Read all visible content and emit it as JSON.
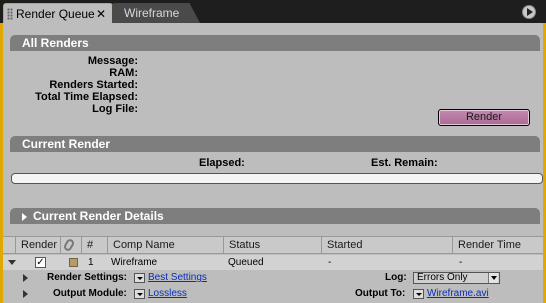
{
  "tabs": [
    {
      "label": "Render Queue",
      "close": "✕"
    },
    {
      "label": "Wireframe"
    }
  ],
  "all_renders": {
    "title": "All Renders",
    "fields": [
      {
        "label": "Message:"
      },
      {
        "label": "RAM:"
      },
      {
        "label": "Renders Started:"
      },
      {
        "label": "Total Time Elapsed:"
      },
      {
        "label": "Log File:"
      }
    ],
    "render_button": "Render"
  },
  "current_render": {
    "title": "Current Render",
    "elapsed_label": "Elapsed:",
    "remain_label": "Est. Remain:",
    "progress": 0
  },
  "details": {
    "title": "Current Render Details"
  },
  "table": {
    "headers": {
      "render": "Render",
      "num": "#",
      "comp": "Comp Name",
      "status": "Status",
      "started": "Started",
      "time": "Render Time"
    },
    "item": {
      "checked": "✓",
      "num": "1",
      "comp": "Wireframe",
      "status": "Queued",
      "started": "-",
      "time": "-"
    },
    "render_settings": {
      "label": "Render Settings:",
      "value": "Best Settings",
      "log_label": "Log:",
      "log_value": "Errors Only"
    },
    "output_module": {
      "label": "Output Module:",
      "value": "Lossless",
      "output_label": "Output To:",
      "output_value": "Wireframe.avi"
    }
  }
}
